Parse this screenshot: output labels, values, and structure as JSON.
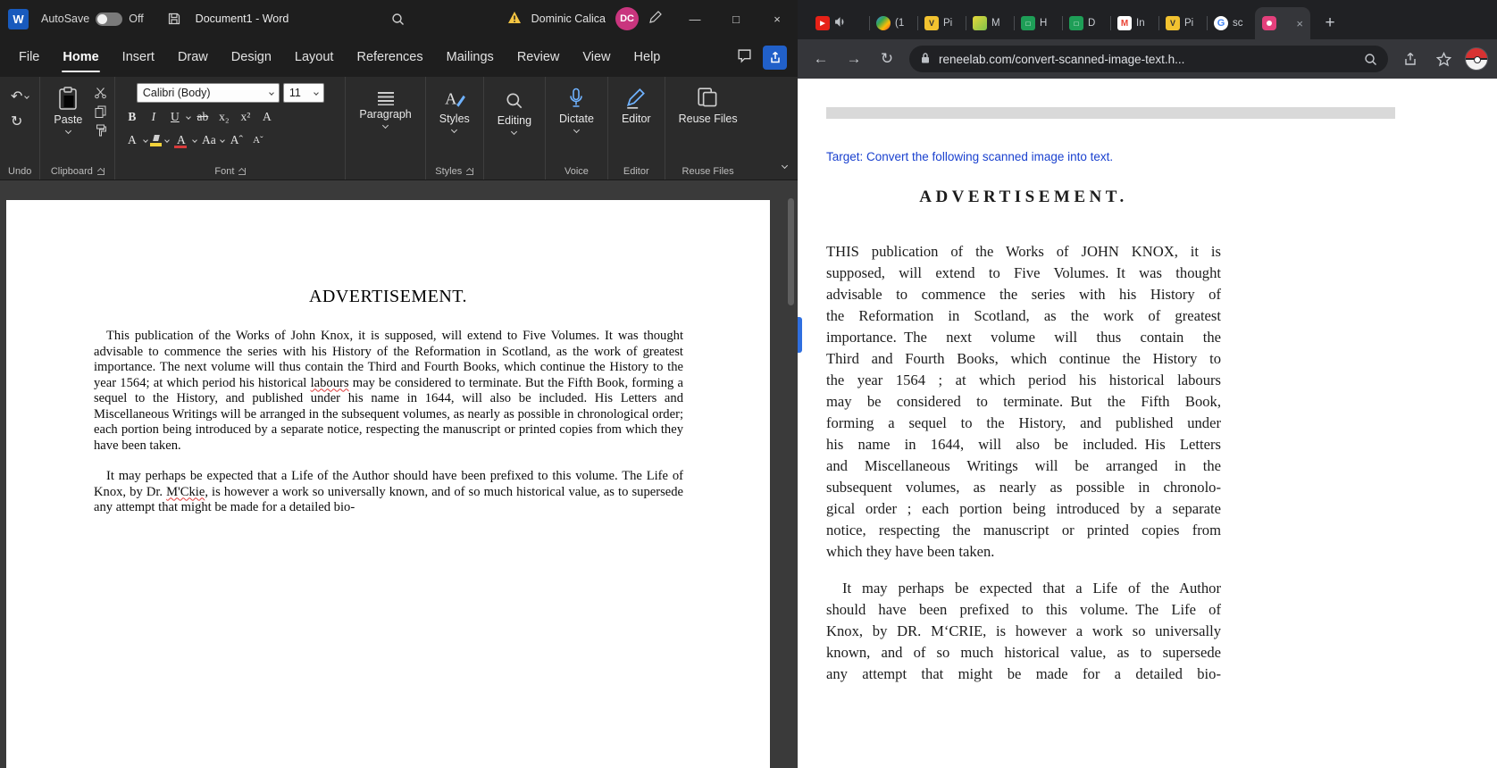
{
  "word": {
    "titlebar": {
      "autosave_label": "AutoSave",
      "autosave_state": "Off",
      "document_title": "Document1  -  Word",
      "user_name": "Dominic Calica",
      "user_initials": "DC"
    },
    "tabs": [
      "File",
      "Home",
      "Insert",
      "Draw",
      "Design",
      "Layout",
      "References",
      "Mailings",
      "Review",
      "View",
      "Help"
    ],
    "active_tab": "Home",
    "ribbon": {
      "undo": {
        "label": "Undo"
      },
      "clipboard": {
        "paste_label": "Paste",
        "label": "Clipboard"
      },
      "font": {
        "name": "Calibri (Body)",
        "size": "11",
        "label": "Font",
        "buttons": {
          "bold": "B",
          "italic": "I",
          "underline": "U",
          "strikethrough": "ab",
          "subscript": "x₂",
          "superscript": "x²",
          "clear_formatting": "A",
          "text_effects": "A",
          "font_color": "A",
          "change_case": "Aa",
          "grow_font": "Aˆ",
          "shrink_font": "Aˇ"
        }
      },
      "paragraph": {
        "label": "Paragraph"
      },
      "styles": {
        "label": "Styles"
      },
      "editing": {
        "label": "Editing"
      },
      "dictate": {
        "label": "Dictate",
        "group_label": "Voice"
      },
      "editor": {
        "label": "Editor",
        "group_label": "Editor"
      },
      "reuse": {
        "label": "Reuse Files",
        "group_label": "Reuse Files"
      }
    },
    "document": {
      "heading": "ADVERTISEMENT.",
      "para1_before": "This publication of the Works of John Knox, it is supposed, will extend to Five Volumes. It was thought advisable to commence the series with his History of the Reformation in Scotland, as the work of greatest importance. The next volume will thus contain the Third and Fourth Books, which continue the History to the year 1564; at which period his historical ",
      "para1_misspelled": "labours",
      "para1_after": " may be considered to terminate. But the Fifth Book, forming a sequel to the History, and published under his name in 1644, will also be included. His Letters and Miscellaneous Writings will be arranged in the subsequent volumes, as nearly as possible in chronological order; each portion being introduced by a separate notice, respecting the manuscript or printed copies from which they have been taken.",
      "para2_before": "It may perhaps be expected that a Life of the Author should have been prefixed to this volume. The Life of Knox, by Dr. ",
      "para2_misspelled": "M'Ckie",
      "para2_after": ", is however a work so universally known, and of so much historical value, as to supersede any attempt that might be made for a detailed bio-"
    }
  },
  "browser": {
    "tabs": [
      {
        "icon": "youtube-icon",
        "label": "",
        "audio": true
      },
      {
        "icon": "chat-app-icon",
        "label": "(1"
      },
      {
        "icon": "yellow-app-icon",
        "label": "Pi"
      },
      {
        "icon": "lime-app-icon",
        "label": "M"
      },
      {
        "icon": "green-sheet-icon",
        "label": "H"
      },
      {
        "icon": "green-sheet-icon",
        "label": "D"
      },
      {
        "icon": "gmail-icon",
        "label": "In"
      },
      {
        "icon": "yellow-app-icon",
        "label": "Pi"
      },
      {
        "icon": "google-icon",
        "label": "sc"
      },
      {
        "icon": "pink-app-icon",
        "label": "",
        "active": true
      }
    ],
    "url": "reneelab.com/convert-scanned-image-text.h...",
    "page": {
      "target_line": "Target: Convert the following scanned image into text.",
      "scan_heading": "ADVERTISEMENT.",
      "scan_para1_lines": [
        "THIS publication of the Works of JOHN KNOX, it is",
        "supposed, will extend to Five Volumes. It was thought",
        "advisable to commence the series with his History of",
        "the Reformation in Scotland, as the work of greatest",
        "importance. The next volume will thus contain the",
        "Third and Fourth Books, which continue the History to",
        "the year 1564 ; at which period his historical labours",
        "may be considered to terminate. But the Fifth Book,",
        "forming a sequel to the History, and published under",
        "his name in 1644, will also be included. His Letters",
        "and Miscellaneous Writings will be arranged in the",
        "subsequent volumes, as nearly as possible in chronolo-",
        "gical order ; each portion being introduced by a separate",
        "notice, respecting the manuscript or printed copies from"
      ],
      "scan_para1_last": "which they have been taken.",
      "scan_para2_lines": [
        "It may perhaps be expected that a Life of the Author",
        "should have been prefixed to this volume. The Life of",
        "Knox, by DR. M‘CRIE, is however a work so universally",
        "known, and of so much historical value, as to supersede",
        "any attempt that might be made for a detailed bio-"
      ]
    }
  },
  "colors": {
    "word_accent_blue": "#185abd",
    "share_button_blue": "#2160c9",
    "avatar_pink": "#c9357e",
    "target_text_blue": "#1a41cf",
    "squiggle_red": "#e03b3b",
    "highlight_yellow": "#f3d23a"
  }
}
